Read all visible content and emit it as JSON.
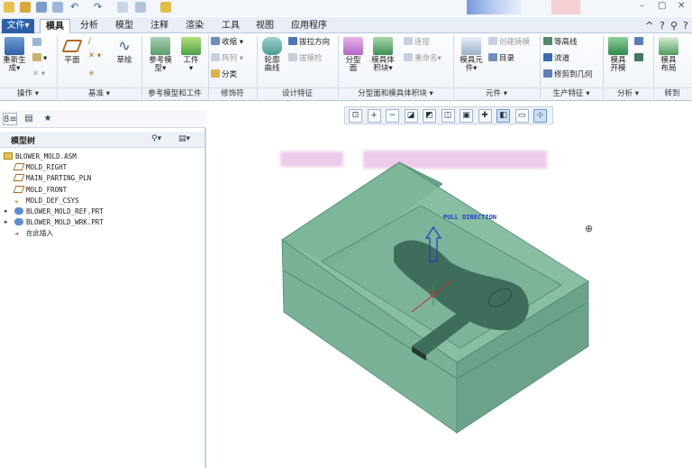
{
  "window": {
    "controls": [
      "–",
      "▢",
      "✕"
    ]
  },
  "menu": {
    "tabs": [
      {
        "label": "文件▾",
        "active": false,
        "file": true
      },
      {
        "label": "模具",
        "active": true
      },
      {
        "label": "分析",
        "active": false
      },
      {
        "label": "模型",
        "active": false
      },
      {
        "label": "注释",
        "active": false
      },
      {
        "label": "渲染",
        "active": false
      },
      {
        "label": "工具",
        "active": false
      },
      {
        "label": "视图",
        "active": false
      },
      {
        "label": "应用程序",
        "active": false
      }
    ],
    "right_icons": [
      "^",
      "?",
      "⚲",
      "?"
    ]
  },
  "ribbon": {
    "regenerate": {
      "label": "重新生",
      "label2": "成▾"
    },
    "plane": {
      "label": "平面"
    },
    "sketch": {
      "label": "草绘"
    },
    "ref_model": {
      "label": "参考模",
      "label2": "型▾"
    },
    "workpiece": {
      "label": "工件",
      "label2": "▾"
    },
    "shrink": {
      "label": "收缩 ▾"
    },
    "pattern": {
      "label": "阵列 ▾"
    },
    "classify": {
      "label": "分类"
    },
    "contour": {
      "label": "轮廓",
      "label2": "曲线"
    },
    "skirt": {
      "label": "裙边"
    },
    "draft_dir": {
      "label": "拔拉方向"
    },
    "draft_check": {
      "label": "拔模检"
    },
    "parting_surface": {
      "label": "分型",
      "label2": "面"
    },
    "mold_volume": {
      "label": "模具体",
      "label2": "积块▾"
    },
    "connect": {
      "label": "连接"
    },
    "rename": {
      "label": "重命名▾"
    },
    "mold_component": {
      "label": "模具元",
      "label2": "件▾"
    },
    "create_cast": {
      "label": "创建铸模"
    },
    "catalog": {
      "label": "目录"
    },
    "equal_line": {
      "label": "等高线"
    },
    "runner": {
      "label": "流道"
    },
    "fix_geometry": {
      "label": "修剪到几何"
    },
    "mold_open": {
      "label": "模具",
      "label2": "开模"
    },
    "mold_layout": {
      "label": "模具",
      "label2": "布局"
    },
    "groups": [
      "操作 ▾",
      "基准 ▾",
      "参考模型和工件",
      "修饰符",
      "设计特征",
      "分型面和模具体积块 ▾",
      "元件 ▾",
      "生产特征 ▾",
      "分析 ▾",
      "转到"
    ]
  },
  "graphics_toolbar": {
    "buttons": [
      {
        "icon": "zoom-fit-icon",
        "glyph": "⊡",
        "on": false
      },
      {
        "icon": "zoom-in-icon",
        "glyph": "+",
        "on": false
      },
      {
        "icon": "zoom-out-icon",
        "glyph": "−",
        "on": false
      },
      {
        "icon": "repaint-icon",
        "glyph": "◪",
        "on": false
      },
      {
        "icon": "orient-icon",
        "glyph": "◩",
        "on": false
      },
      {
        "icon": "saved-views-icon",
        "glyph": "◫",
        "on": false
      },
      {
        "icon": "display-style-icon",
        "glyph": "▣",
        "on": false
      },
      {
        "icon": "datum-display-icon",
        "glyph": "✚",
        "on": false
      },
      {
        "icon": "plane-display-icon",
        "glyph": "◧",
        "on": true
      },
      {
        "icon": "axis-display-icon",
        "glyph": "▭",
        "on": false
      },
      {
        "icon": "point-display-icon",
        "glyph": "⊹",
        "on": true
      }
    ]
  },
  "left_panel": {
    "tabs": [
      "8≡",
      "▤",
      "★"
    ],
    "tree_title": "模型树",
    "tree_buttons": [
      "⚲▾",
      "▤▾"
    ],
    "nodes": [
      {
        "label": "BLOWER_MOLD.ASM",
        "icon": "assembly-icon",
        "expandable": false,
        "indent": 0
      },
      {
        "label": "MOLD_RIGHT",
        "icon": "datum-plane-icon",
        "expandable": false,
        "indent": 1
      },
      {
        "label": "MAIN_PARTING_PLN",
        "icon": "datum-plane-icon",
        "expandable": false,
        "indent": 1
      },
      {
        "label": "MOLD_FRONT",
        "icon": "datum-plane-icon",
        "expandable": false,
        "indent": 1
      },
      {
        "label": "MOLD_DEF_CSYS",
        "icon": "csys-icon",
        "expandable": false,
        "indent": 1
      },
      {
        "label": "BLOWER_MOLD_REF.PRT",
        "icon": "part-icon",
        "expandable": true,
        "indent": 1
      },
      {
        "label": "BLOWER_MOLD_WRK.PRT",
        "icon": "part-icon",
        "expandable": true,
        "indent": 1
      },
      {
        "label": "在此插入",
        "icon": "insert-here-icon",
        "expandable": false,
        "indent": 1
      }
    ]
  },
  "viewport": {
    "pull_direction_label": "PULL DIRECTION",
    "colors": {
      "block_top": "#7fb89b",
      "block_front": "#6fab8f",
      "block_side": "#5e9b80",
      "part": "#3f6d5c",
      "arrow": "#1c3cc8"
    }
  }
}
